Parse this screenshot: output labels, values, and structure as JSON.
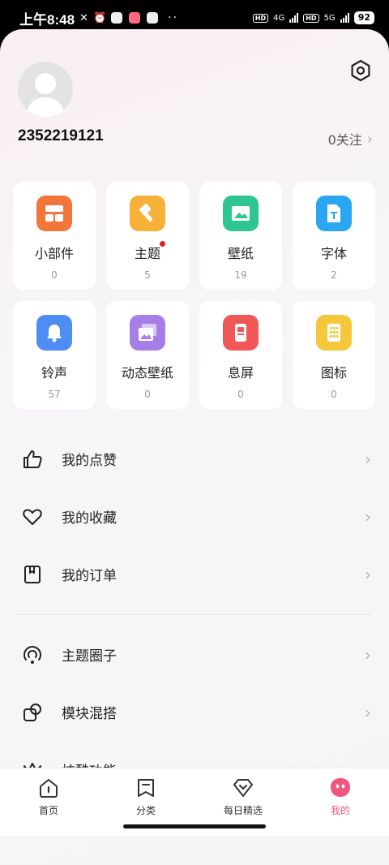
{
  "status_bar": {
    "time": "上午8:48",
    "net1": "4G",
    "net2": "5G",
    "battery": "92",
    "hd": "HD"
  },
  "profile": {
    "username": "2352219121",
    "follow_text": "0关注",
    "follow_chevron": "›"
  },
  "tiles": [
    {
      "label": "小部件",
      "count": "0",
      "color": "#f2763a",
      "icon": "widget-icon"
    },
    {
      "label": "主题",
      "count": "5",
      "color": "#f7b038",
      "icon": "theme-brush-icon",
      "badge": true
    },
    {
      "label": "壁纸",
      "count": "19",
      "color": "#2ec690",
      "icon": "wallpaper-icon"
    },
    {
      "label": "字体",
      "count": "2",
      "color": "#29a7f0",
      "icon": "font-icon"
    },
    {
      "label": "铃声",
      "count": "57",
      "color": "#4f8df5",
      "icon": "bell-icon"
    },
    {
      "label": "动态壁纸",
      "count": "0",
      "color": "#a67ee8",
      "icon": "live-wallpaper-icon"
    },
    {
      "label": "息屏",
      "count": "0",
      "color": "#f25757",
      "icon": "aod-icon"
    },
    {
      "label": "图标",
      "count": "0",
      "color": "#f5c73a",
      "icon": "app-icons-icon"
    }
  ],
  "menu": [
    {
      "label": "我的点赞",
      "icon": "thumbs-up-icon",
      "name": "my-likes"
    },
    {
      "label": "我的收藏",
      "icon": "heart-icon",
      "name": "my-favorites"
    },
    {
      "label": "我的订单",
      "icon": "bookmark-icon",
      "name": "my-orders"
    },
    {
      "label": "主题圈子",
      "icon": "circle-community-icon",
      "name": "theme-circle"
    },
    {
      "label": "模块混搭",
      "icon": "module-mix-icon",
      "name": "module-mix"
    },
    {
      "label": "炫酷功能",
      "icon": "crown-icon",
      "name": "cool-features"
    }
  ],
  "menu_chevron": "›",
  "bottom_nav": [
    {
      "label": "首页",
      "icon": "home-icon",
      "active": false
    },
    {
      "label": "分类",
      "icon": "category-icon",
      "active": false
    },
    {
      "label": "每日精选",
      "icon": "diamond-icon",
      "active": false
    },
    {
      "label": "我的",
      "icon": "profile-face-icon",
      "active": true
    }
  ],
  "colors": {
    "accent": "#f0567f",
    "badge": "#e02020"
  }
}
